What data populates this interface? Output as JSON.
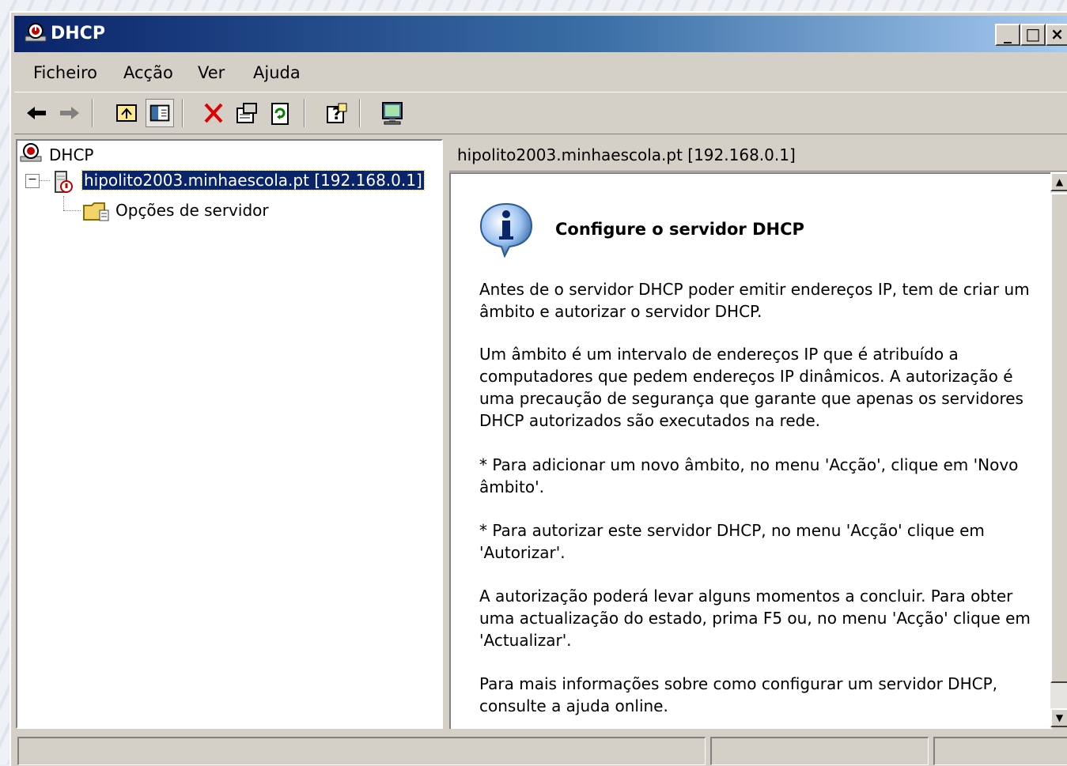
{
  "window": {
    "title": "DHCP",
    "buttons": {
      "minimize": "_",
      "maximize": "□",
      "close": "×"
    }
  },
  "menu": {
    "items": [
      {
        "label": "Ficheiro",
        "icon": ""
      },
      {
        "label": "Acção"
      },
      {
        "label": "Ver"
      },
      {
        "label": "Ajuda"
      }
    ]
  },
  "toolbar": {
    "icons": [
      "back-arrow-icon",
      "forward-arrow-icon",
      "up-one-level-icon",
      "show-hide-console-tree-icon",
      "delete-icon",
      "properties-icon",
      "refresh-icon",
      "help-icon",
      "console-icon"
    ]
  },
  "tree": {
    "root_label": "DHCP",
    "server_label": "hipolito2003.minhaescola.pt [192.168.0.1]",
    "child_label": "Opções de servidor",
    "expander": "−"
  },
  "panel": {
    "header": "hipolito2003.minhaescola.pt [192.168.0.1]",
    "info_title": "Configure o servidor DHCP",
    "paragraphs": [
      "Antes de o servidor DHCP poder emitir endereços IP, tem de criar um âmbito e autorizar o servidor DHCP.",
      "Um âmbito é um intervalo de endereços IP que é atribuído a computadores que pedem endereços IP dinâmicos. A autorização é uma precaução de segurança que garante que apenas os servidores DHCP autorizados são executados na rede.",
      "* Para adicionar um novo âmbito, no menu 'Acção', clique em 'Novo âmbito'.",
      "* Para autorizar este servidor DHCP, no menu 'Acção' clique em 'Autorizar'.",
      "A autorização poderá levar alguns momentos a concluir. Para obter uma actualização do estado, prima F5 ou, no menu 'Acção' clique em 'Actualizar'.",
      "Para mais informações sobre como configurar um servidor DHCP, consulte a ajuda online."
    ]
  },
  "colors": {
    "titlebar_start": "#0a246a",
    "titlebar_end": "#a6caf0",
    "selection": "#0a246a",
    "window_face": "#d4d0c8"
  }
}
